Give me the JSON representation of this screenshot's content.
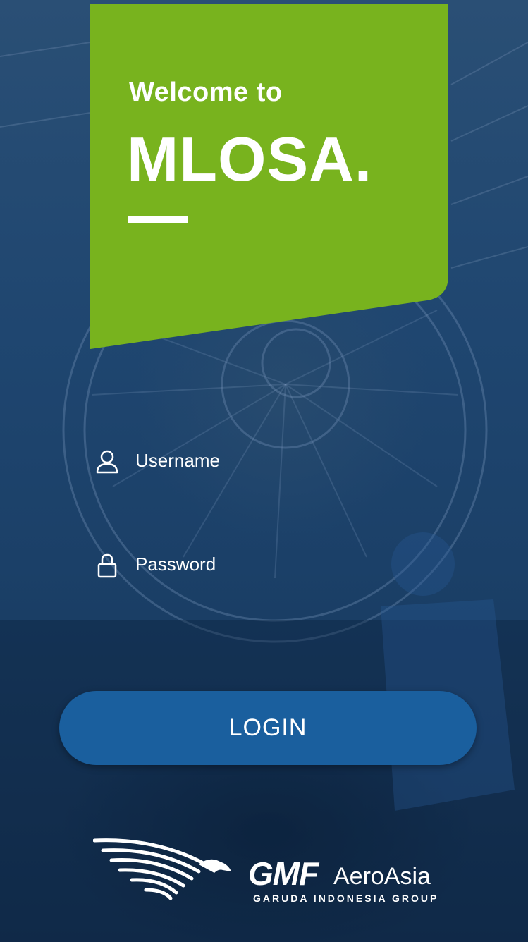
{
  "hero": {
    "welcome": "Welcome to",
    "brand": "MLOSA.",
    "color": "#78b31e"
  },
  "form": {
    "username_label": "Username",
    "username_icon": "user-icon",
    "password_label": "Password",
    "password_icon": "lock-icon",
    "login_label": "LOGIN",
    "button_color": "#1a5f9e"
  },
  "footer": {
    "logo_main": "GMF",
    "logo_aero": "AeroAsia",
    "logo_sub": "GARUDA INDONESIA GROUP",
    "logo_icon": "garuda-bird-logo"
  }
}
